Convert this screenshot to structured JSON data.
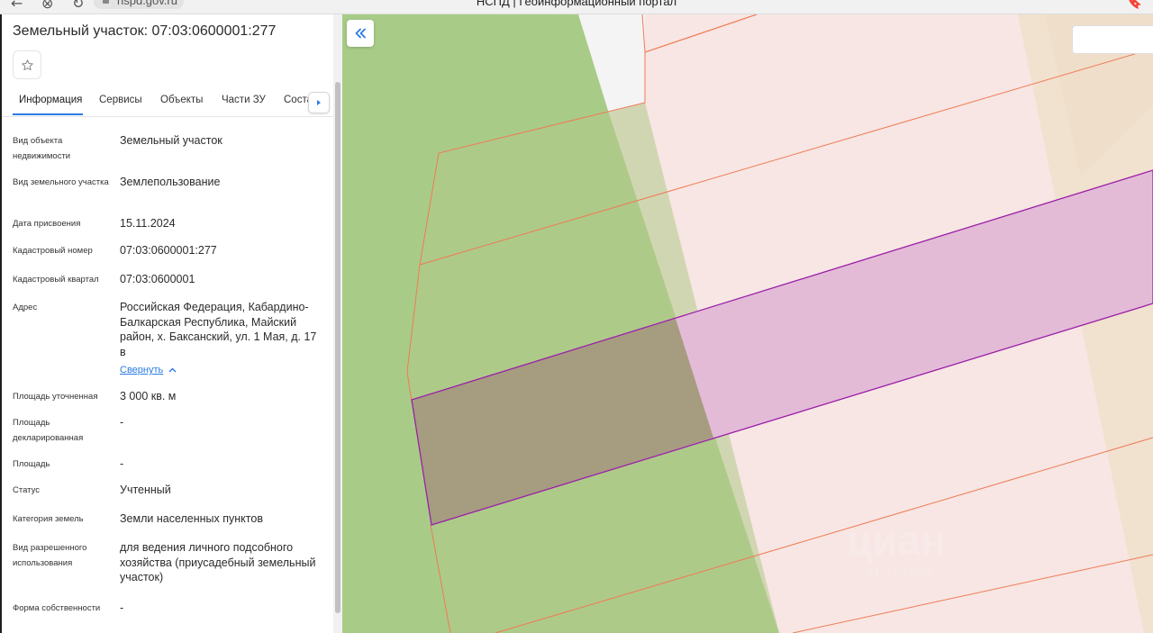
{
  "browser": {
    "url": "nspd.gov.ru",
    "tab_title": "НСПД | Геоинформационный портал",
    "nav_icons": [
      "back-arrow-icon",
      "shield-icon",
      "reload-icon"
    ],
    "bookmark_icon": "bookmark-icon"
  },
  "panel": {
    "title": "Земельный участок: 07:03:0600001:277",
    "tabs": [
      {
        "label": "Информация",
        "active": true
      },
      {
        "label": "Сервисы",
        "active": false
      },
      {
        "label": "Объекты",
        "active": false
      },
      {
        "label": "Части ЗУ",
        "active": false
      },
      {
        "label": "Соста",
        "active": false
      }
    ],
    "accent_color": "#2a7be4",
    "rows": [
      {
        "label": "Вид объекта недвижимости",
        "value": "Земельный участок"
      },
      {
        "label": "Вид земельного участка",
        "value": "Землепользование"
      },
      {
        "label": "Дата присвоения",
        "value": "15.11.2024"
      },
      {
        "label": "Кадастровый номер",
        "value": "07:03:0600001:277"
      },
      {
        "label": "Кадастровый квартал",
        "value": "07:03:0600001"
      },
      {
        "label": "Адрес",
        "value": "Российская Федерация, Кабардино-Балкарская Республика, Майский район, х. Баксанский, ул. 1 Мая, д. 17 в"
      },
      {
        "label": "Площадь уточненная",
        "value": "3 000 кв. м"
      },
      {
        "label": "Площадь декларированная",
        "value": "-"
      },
      {
        "label": "Площадь",
        "value": "-"
      },
      {
        "label": "Статус",
        "value": "Учтенный"
      },
      {
        "label": "Категория земель",
        "value": "Земли населенных пунктов"
      },
      {
        "label": "Вид разрешенного использования",
        "value": "для ведения личного подсобного хозяйства (приусадебный земельный участок)"
      },
      {
        "label": "Форма собственности",
        "value": "-"
      }
    ],
    "collapse_link": "Свернуть"
  },
  "map": {
    "colors": {
      "green": "#a8cc88",
      "parcel_pink": "#f7e6e3",
      "tan": "#f1e1cf",
      "white_area": "#f4f4f4",
      "boundary": "#f07a55",
      "selected_fill": "#e3bbd7",
      "selected_stroke": "#9b1fa8"
    },
    "watermark": "циан",
    "watermark_id": "ID 313739..."
  }
}
